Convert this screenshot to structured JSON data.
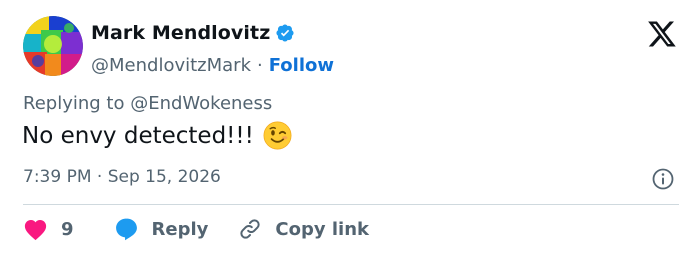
{
  "author": {
    "display_name": "Mark Mendlovitz",
    "handle": "@MendlovitzMark",
    "separator": "·",
    "follow_label": "Follow",
    "verified": true
  },
  "tweet": {
    "replying_to": "Replying to @EndWokeness",
    "text": "No envy detected!!!",
    "emoji": "winking-face",
    "timestamp": "7:39 PM · Sep 15, 2026"
  },
  "actions": {
    "like_count": "9",
    "reply_label": "Reply",
    "copy_label": "Copy link"
  },
  "colors": {
    "text": "#0f1419",
    "secondary": "#536471",
    "follow": "#0f71d6",
    "verified": "#1d9bf0",
    "heart": "#f91880",
    "reply_bubble": "#1d9bf0",
    "divider": "#cfd9de"
  },
  "icons": [
    "verified-badge-icon",
    "x-logo-icon",
    "winking-face-emoji",
    "info-icon",
    "heart-icon",
    "reply-bubble-icon",
    "link-icon"
  ]
}
